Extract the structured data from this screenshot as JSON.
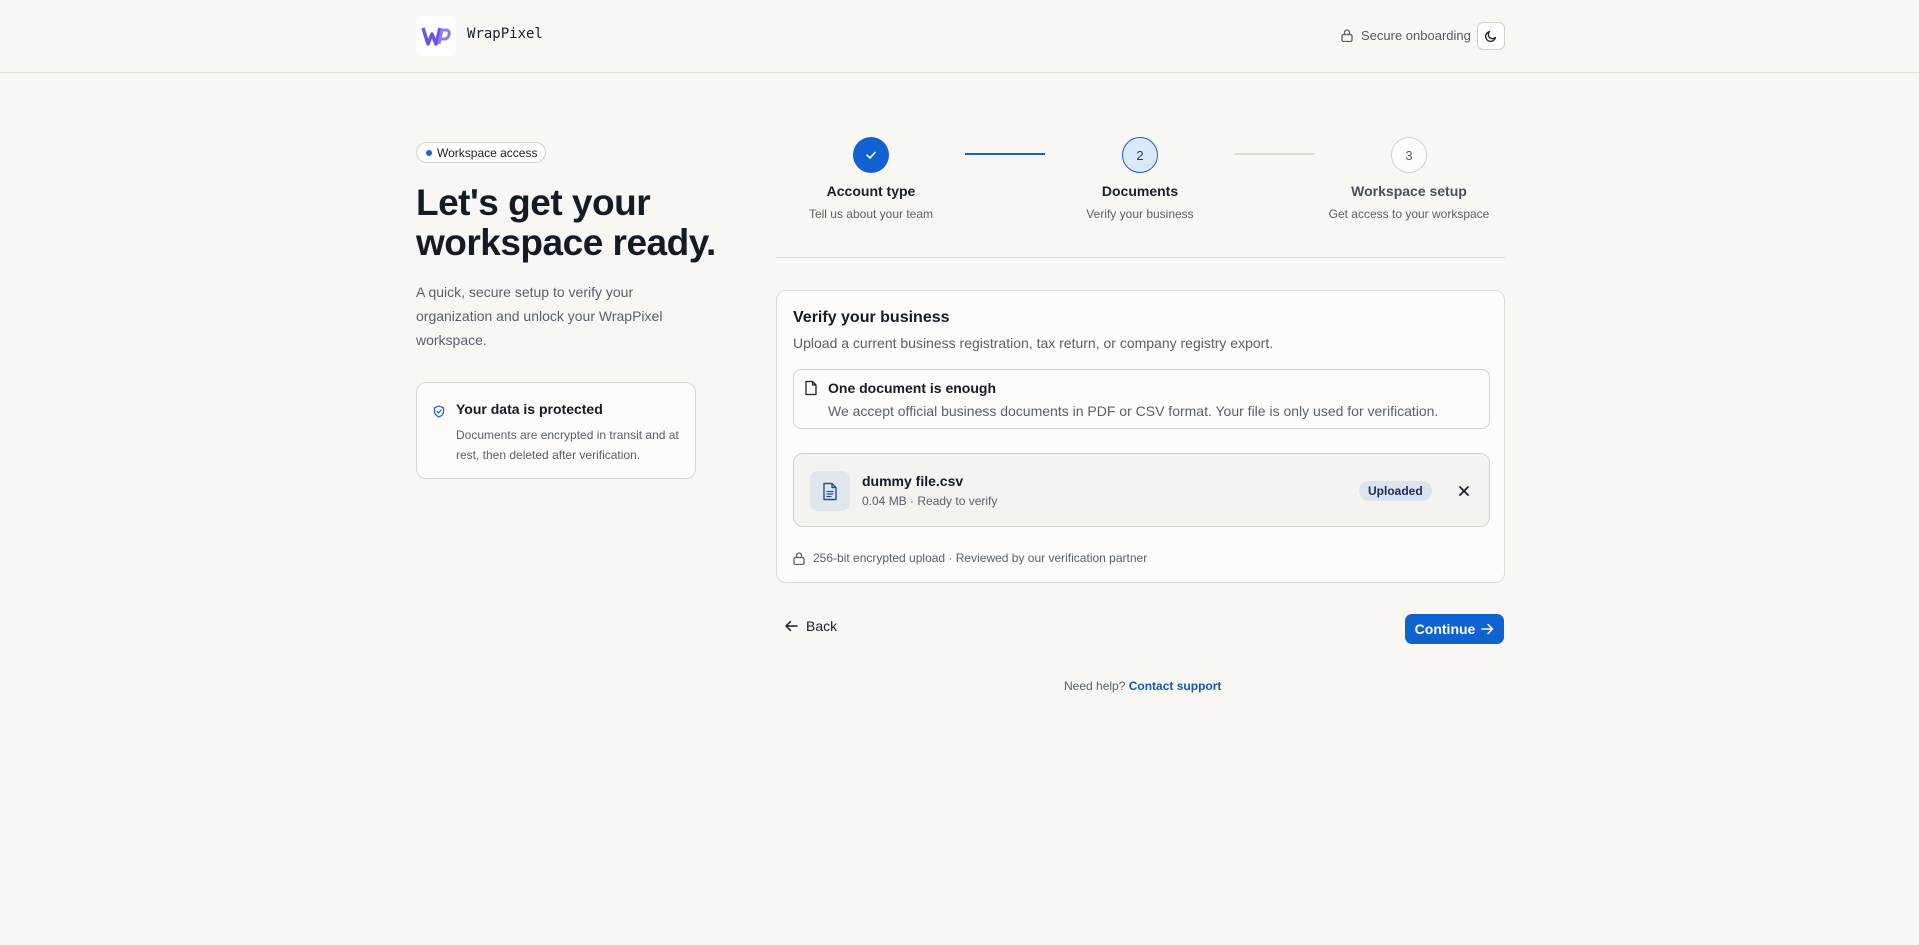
{
  "header": {
    "brand": "WrapPixel",
    "secure_label": "Secure onboarding",
    "icons": {
      "logo": "wrappixel-logo",
      "secure": "lock-icon",
      "theme": "moon-icon"
    }
  },
  "intro": {
    "pill": "Workspace access",
    "title": "Let's get your workspace ready.",
    "subtitle": "A quick, secure setup to verify your organization and unlock your WrapPixel workspace.",
    "protect": {
      "title": "Your data is protected",
      "text": "Documents are encrypted in transit and at rest, then deleted after verification."
    }
  },
  "stepper": {
    "steps": [
      {
        "number": "1",
        "title": "Account type",
        "subtitle": "Tell us about your team",
        "state": "done"
      },
      {
        "number": "2",
        "title": "Documents",
        "subtitle": "Verify your business",
        "state": "active"
      },
      {
        "number": "3",
        "title": "Workspace setup",
        "subtitle": "Get access to your workspace",
        "state": "todo"
      }
    ]
  },
  "verify": {
    "title": "Verify your business",
    "subtitle": "Upload a current business registration, tax return, or company registry export.",
    "notice": {
      "title": "One document is enough",
      "text": "We accept official business documents in PDF or CSV format. Your file is only used for verification."
    },
    "file": {
      "name": "dummy file.csv",
      "meta": "0.04 MB · Ready to verify",
      "status": "Uploaded"
    },
    "encryption_note": "256-bit encrypted upload · Reviewed by our verification partner"
  },
  "actions": {
    "back": "Back",
    "continue": "Continue"
  },
  "help": {
    "prefix": "Need help?",
    "link": "Contact support"
  },
  "colors": {
    "accent": "#0f63d1",
    "background": "#f8f7f4",
    "text": "#141a26",
    "muted": "#5a606b"
  }
}
